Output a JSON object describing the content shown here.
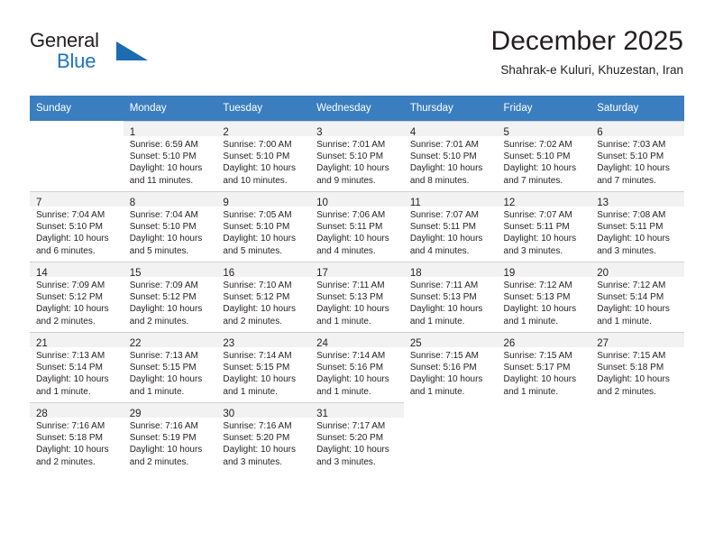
{
  "brand": {
    "name_part1": "General",
    "name_part2": "Blue",
    "triangle_color": "#1b6cb0",
    "blue_color": "#1b75bb"
  },
  "header": {
    "title": "December 2025",
    "subtitle": "Shahrak-e Kuluri, Khuzestan, Iran"
  },
  "theme": {
    "header_row_bg": "#3a7ebf",
    "daynum_bg": "#f2f2f2",
    "grid_line": "#d0d0d0",
    "text": "#231f20"
  },
  "weekdays": [
    "Sunday",
    "Monday",
    "Tuesday",
    "Wednesday",
    "Thursday",
    "Friday",
    "Saturday"
  ],
  "weeks": [
    [
      {
        "day": "",
        "sunrise": "",
        "sunset": "",
        "daylight1": "",
        "daylight2": "",
        "empty": true
      },
      {
        "day": "1",
        "sunrise": "Sunrise: 6:59 AM",
        "sunset": "Sunset: 5:10 PM",
        "daylight1": "Daylight: 10 hours",
        "daylight2": "and 11 minutes."
      },
      {
        "day": "2",
        "sunrise": "Sunrise: 7:00 AM",
        "sunset": "Sunset: 5:10 PM",
        "daylight1": "Daylight: 10 hours",
        "daylight2": "and 10 minutes."
      },
      {
        "day": "3",
        "sunrise": "Sunrise: 7:01 AM",
        "sunset": "Sunset: 5:10 PM",
        "daylight1": "Daylight: 10 hours",
        "daylight2": "and 9 minutes."
      },
      {
        "day": "4",
        "sunrise": "Sunrise: 7:01 AM",
        "sunset": "Sunset: 5:10 PM",
        "daylight1": "Daylight: 10 hours",
        "daylight2": "and 8 minutes."
      },
      {
        "day": "5",
        "sunrise": "Sunrise: 7:02 AM",
        "sunset": "Sunset: 5:10 PM",
        "daylight1": "Daylight: 10 hours",
        "daylight2": "and 7 minutes."
      },
      {
        "day": "6",
        "sunrise": "Sunrise: 7:03 AM",
        "sunset": "Sunset: 5:10 PM",
        "daylight1": "Daylight: 10 hours",
        "daylight2": "and 7 minutes."
      }
    ],
    [
      {
        "day": "7",
        "sunrise": "Sunrise: 7:04 AM",
        "sunset": "Sunset: 5:10 PM",
        "daylight1": "Daylight: 10 hours",
        "daylight2": "and 6 minutes."
      },
      {
        "day": "8",
        "sunrise": "Sunrise: 7:04 AM",
        "sunset": "Sunset: 5:10 PM",
        "daylight1": "Daylight: 10 hours",
        "daylight2": "and 5 minutes."
      },
      {
        "day": "9",
        "sunrise": "Sunrise: 7:05 AM",
        "sunset": "Sunset: 5:10 PM",
        "daylight1": "Daylight: 10 hours",
        "daylight2": "and 5 minutes."
      },
      {
        "day": "10",
        "sunrise": "Sunrise: 7:06 AM",
        "sunset": "Sunset: 5:11 PM",
        "daylight1": "Daylight: 10 hours",
        "daylight2": "and 4 minutes."
      },
      {
        "day": "11",
        "sunrise": "Sunrise: 7:07 AM",
        "sunset": "Sunset: 5:11 PM",
        "daylight1": "Daylight: 10 hours",
        "daylight2": "and 4 minutes."
      },
      {
        "day": "12",
        "sunrise": "Sunrise: 7:07 AM",
        "sunset": "Sunset: 5:11 PM",
        "daylight1": "Daylight: 10 hours",
        "daylight2": "and 3 minutes."
      },
      {
        "day": "13",
        "sunrise": "Sunrise: 7:08 AM",
        "sunset": "Sunset: 5:11 PM",
        "daylight1": "Daylight: 10 hours",
        "daylight2": "and 3 minutes."
      }
    ],
    [
      {
        "day": "14",
        "sunrise": "Sunrise: 7:09 AM",
        "sunset": "Sunset: 5:12 PM",
        "daylight1": "Daylight: 10 hours",
        "daylight2": "and 2 minutes."
      },
      {
        "day": "15",
        "sunrise": "Sunrise: 7:09 AM",
        "sunset": "Sunset: 5:12 PM",
        "daylight1": "Daylight: 10 hours",
        "daylight2": "and 2 minutes."
      },
      {
        "day": "16",
        "sunrise": "Sunrise: 7:10 AM",
        "sunset": "Sunset: 5:12 PM",
        "daylight1": "Daylight: 10 hours",
        "daylight2": "and 2 minutes."
      },
      {
        "day": "17",
        "sunrise": "Sunrise: 7:11 AM",
        "sunset": "Sunset: 5:13 PM",
        "daylight1": "Daylight: 10 hours",
        "daylight2": "and 1 minute."
      },
      {
        "day": "18",
        "sunrise": "Sunrise: 7:11 AM",
        "sunset": "Sunset: 5:13 PM",
        "daylight1": "Daylight: 10 hours",
        "daylight2": "and 1 minute."
      },
      {
        "day": "19",
        "sunrise": "Sunrise: 7:12 AM",
        "sunset": "Sunset: 5:13 PM",
        "daylight1": "Daylight: 10 hours",
        "daylight2": "and 1 minute."
      },
      {
        "day": "20",
        "sunrise": "Sunrise: 7:12 AM",
        "sunset": "Sunset: 5:14 PM",
        "daylight1": "Daylight: 10 hours",
        "daylight2": "and 1 minute."
      }
    ],
    [
      {
        "day": "21",
        "sunrise": "Sunrise: 7:13 AM",
        "sunset": "Sunset: 5:14 PM",
        "daylight1": "Daylight: 10 hours",
        "daylight2": "and 1 minute."
      },
      {
        "day": "22",
        "sunrise": "Sunrise: 7:13 AM",
        "sunset": "Sunset: 5:15 PM",
        "daylight1": "Daylight: 10 hours",
        "daylight2": "and 1 minute."
      },
      {
        "day": "23",
        "sunrise": "Sunrise: 7:14 AM",
        "sunset": "Sunset: 5:15 PM",
        "daylight1": "Daylight: 10 hours",
        "daylight2": "and 1 minute."
      },
      {
        "day": "24",
        "sunrise": "Sunrise: 7:14 AM",
        "sunset": "Sunset: 5:16 PM",
        "daylight1": "Daylight: 10 hours",
        "daylight2": "and 1 minute."
      },
      {
        "day": "25",
        "sunrise": "Sunrise: 7:15 AM",
        "sunset": "Sunset: 5:16 PM",
        "daylight1": "Daylight: 10 hours",
        "daylight2": "and 1 minute."
      },
      {
        "day": "26",
        "sunrise": "Sunrise: 7:15 AM",
        "sunset": "Sunset: 5:17 PM",
        "daylight1": "Daylight: 10 hours",
        "daylight2": "and 1 minute."
      },
      {
        "day": "27",
        "sunrise": "Sunrise: 7:15 AM",
        "sunset": "Sunset: 5:18 PM",
        "daylight1": "Daylight: 10 hours",
        "daylight2": "and 2 minutes."
      }
    ],
    [
      {
        "day": "28",
        "sunrise": "Sunrise: 7:16 AM",
        "sunset": "Sunset: 5:18 PM",
        "daylight1": "Daylight: 10 hours",
        "daylight2": "and 2 minutes."
      },
      {
        "day": "29",
        "sunrise": "Sunrise: 7:16 AM",
        "sunset": "Sunset: 5:19 PM",
        "daylight1": "Daylight: 10 hours",
        "daylight2": "and 2 minutes."
      },
      {
        "day": "30",
        "sunrise": "Sunrise: 7:16 AM",
        "sunset": "Sunset: 5:20 PM",
        "daylight1": "Daylight: 10 hours",
        "daylight2": "and 3 minutes."
      },
      {
        "day": "31",
        "sunrise": "Sunrise: 7:17 AM",
        "sunset": "Sunset: 5:20 PM",
        "daylight1": "Daylight: 10 hours",
        "daylight2": "and 3 minutes."
      },
      {
        "day": "",
        "sunrise": "",
        "sunset": "",
        "daylight1": "",
        "daylight2": "",
        "empty": true
      },
      {
        "day": "",
        "sunrise": "",
        "sunset": "",
        "daylight1": "",
        "daylight2": "",
        "empty": true
      },
      {
        "day": "",
        "sunrise": "",
        "sunset": "",
        "daylight1": "",
        "daylight2": "",
        "empty": true
      }
    ]
  ]
}
